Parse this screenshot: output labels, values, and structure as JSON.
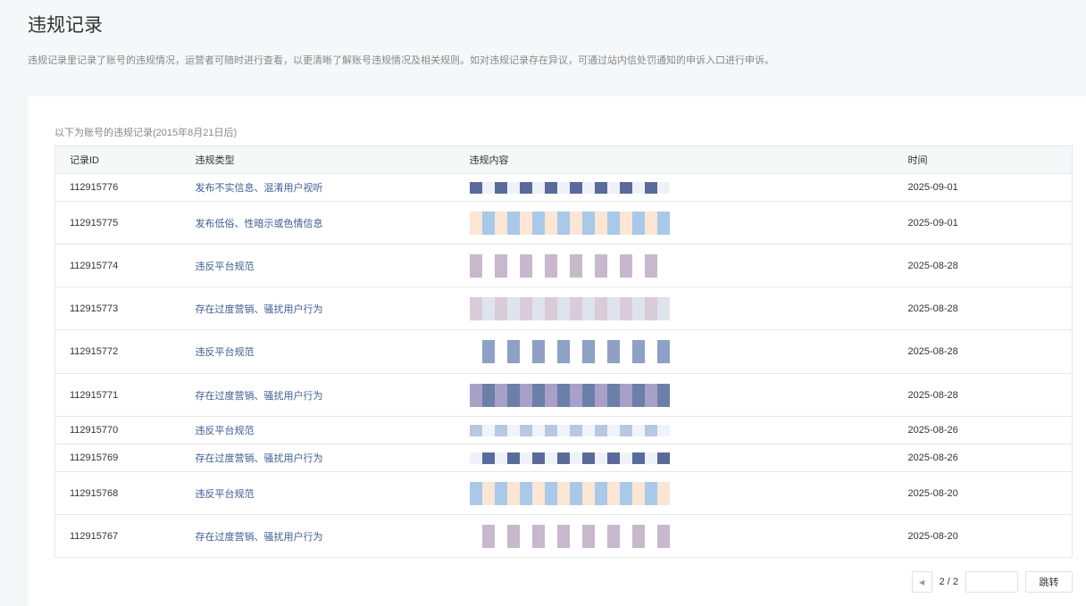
{
  "page": {
    "title": "违规记录",
    "description": "违规记录里记录了账号的违规情况，运营者可随时进行查看，以更清晰了解账号违规情况及相关规则。如对违规记录存在异议，可通过站内信处罚通知的申诉入口进行申诉。"
  },
  "records": {
    "subtitle": "以下为账号的违规记录(2015年8月21日后)",
    "columns": [
      "记录ID",
      "违规类型",
      "违规内容",
      "时间"
    ],
    "rows": [
      {
        "id": "112915776",
        "type": "发布不实信息、混淆用户视听",
        "time": "2025-09-01"
      },
      {
        "id": "112915775",
        "type": "发布低俗、性暗示或色情信息",
        "time": "2025-09-01"
      },
      {
        "id": "112915774",
        "type": "违反平台规范",
        "time": "2025-08-28"
      },
      {
        "id": "112915773",
        "type": "存在过度营销、骚扰用户行为",
        "time": "2025-08-28"
      },
      {
        "id": "112915772",
        "type": "违反平台规范",
        "time": "2025-08-28"
      },
      {
        "id": "112915771",
        "type": "存在过度营销、骚扰用户行为",
        "time": "2025-08-28"
      },
      {
        "id": "112915770",
        "type": "违反平台规范",
        "time": "2025-08-26"
      },
      {
        "id": "112915769",
        "type": "存在过度营销、骚扰用户行为",
        "time": "2025-08-26"
      },
      {
        "id": "112915768",
        "type": "违反平台规范",
        "time": "2025-08-20"
      },
      {
        "id": "112915767",
        "type": "存在过度营销、骚扰用户行为",
        "time": "2025-08-20"
      }
    ]
  },
  "pagination": {
    "page_info": "2 / 2",
    "jump_label": "跳转",
    "input_value": ""
  }
}
